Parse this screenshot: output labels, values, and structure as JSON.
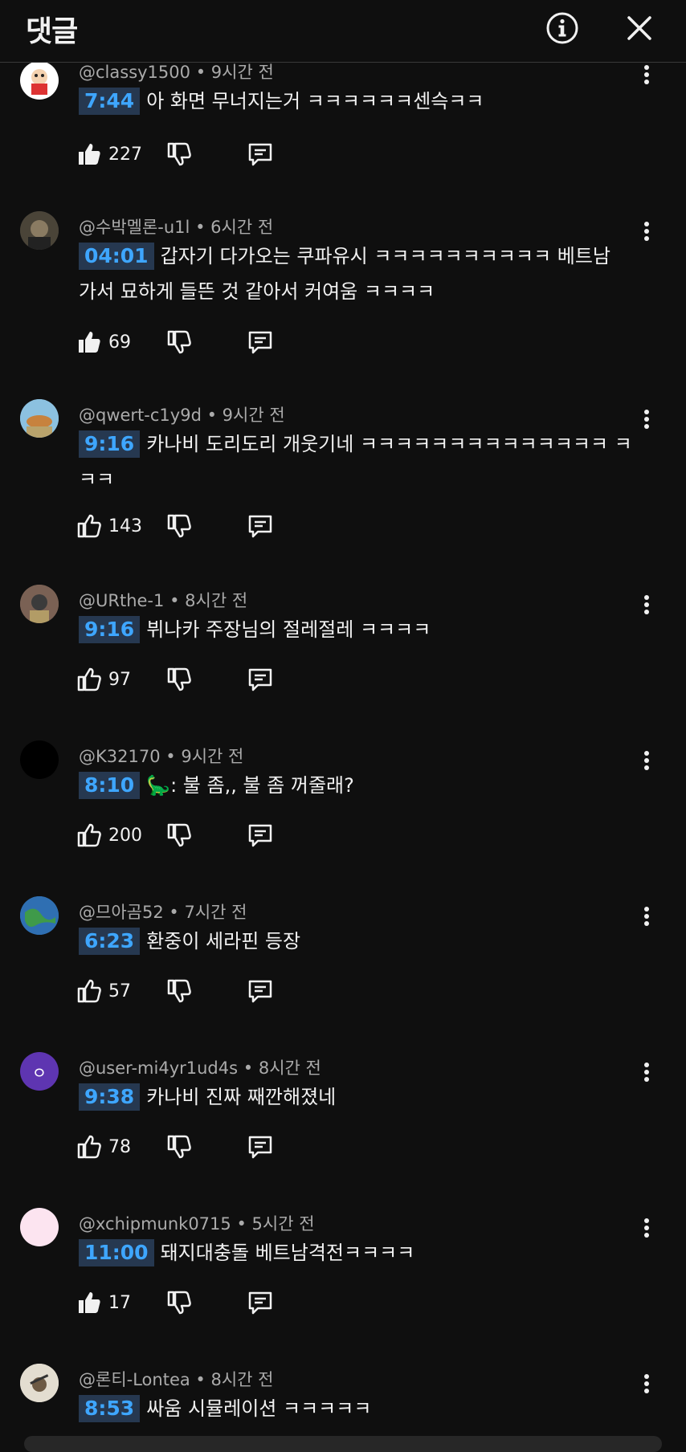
{
  "header": {
    "title": "댓글",
    "info_icon": "info-icon",
    "close_icon": "close-icon"
  },
  "comments": [
    {
      "author": "@classy1500",
      "time": "9시간 전",
      "timestamp": "7:44",
      "text": "아 화면 무너지는거 ㅋㅋㅋㅋㅋㅋ센슥ㅋㅋ",
      "likes": "227",
      "liked": true
    },
    {
      "author": "@수박멜론-u1l",
      "time": "6시간 전",
      "timestamp": "04:01",
      "text": "갑자기 다가오는 쿠파유시 ㅋㅋㅋㅋㅋㅋㅋㅋㅋㅋ 베트남 가서 묘하게 들뜬 것 같아서 커여움 ㅋㅋㅋㅋ",
      "likes": "69",
      "liked": true
    },
    {
      "author": "@qwert-c1y9d",
      "time": "9시간 전",
      "timestamp": "9:16",
      "text": "카나비 도리도리 개웃기네 ㅋㅋㅋㅋㅋㅋㅋㅋㅋㅋㅋㅋㅋㅋ ㅋㅋㅋ",
      "likes": "143",
      "liked": false
    },
    {
      "author": "@URthe-1",
      "time": "8시간 전",
      "timestamp": "9:16",
      "text": "뷔나카 주장님의  절레절레 ㅋㅋㅋㅋ",
      "likes": "97",
      "liked": false
    },
    {
      "author": "@K32170",
      "time": "9시간 전",
      "timestamp": "8:10",
      "text": "🦕: 불 좀,, 불 좀 꺼줄래?",
      "likes": "200",
      "liked": false
    },
    {
      "author": "@므아곰52",
      "time": "7시간 전",
      "timestamp": "6:23",
      "text": "환중이 세라핀 등장",
      "likes": "57",
      "liked": false
    },
    {
      "author": "@user-mi4yr1ud4s",
      "time": "8시간 전",
      "timestamp": "9:38",
      "text": "카나비 진짜 째깐해졌네",
      "likes": "78",
      "liked": false,
      "avatar_letter": "ㅇ"
    },
    {
      "author": "@xchipmunk0715",
      "time": "5시간 전",
      "timestamp": "11:00",
      "text": "돼지대충돌 베트남격전ㅋㅋㅋㅋ",
      "likes": "17",
      "liked": true
    },
    {
      "author": "@론티-Lontea",
      "time": "8시간 전",
      "timestamp": "8:53",
      "text": "싸움 시뮬레이션 ㅋㅋㅋㅋㅋ",
      "likes": "",
      "liked": false
    }
  ],
  "meta_separator": "•",
  "icons": {
    "like": "thumbs-up-icon",
    "dislike": "thumbs-down-icon",
    "reply": "reply-icon",
    "more": "more-vert-icon"
  },
  "colors": {
    "background": "#0f0f0f",
    "timestamp_bg": "#263850",
    "timestamp_text": "#3ea6ff",
    "meta_text": "#aaaaaa"
  }
}
